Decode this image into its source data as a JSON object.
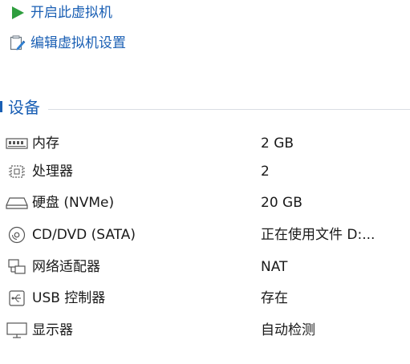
{
  "actions": {
    "power_on": "开启此虚拟机",
    "edit_settings": "编辑虚拟机设置"
  },
  "section": {
    "title": "设备"
  },
  "devices": [
    {
      "name": "内存",
      "value": "2 GB",
      "icon": "memory-icon"
    },
    {
      "name": "处理器",
      "value": "2",
      "icon": "processor-icon"
    },
    {
      "name": "硬盘 (NVMe)",
      "value": "20 GB",
      "icon": "hard-disk-icon"
    },
    {
      "name": "CD/DVD (SATA)",
      "value": "正在使用文件 D:...",
      "icon": "cd-dvd-icon"
    },
    {
      "name": "网络适配器",
      "value": "NAT",
      "icon": "network-adapter-icon"
    },
    {
      "name": "USB 控制器",
      "value": "存在",
      "icon": "usb-controller-icon"
    },
    {
      "name": "显示器",
      "value": "自动检测",
      "icon": "display-icon"
    }
  ],
  "colors": {
    "link": "#1a5fb4",
    "play_green": "#2e9e3e"
  }
}
